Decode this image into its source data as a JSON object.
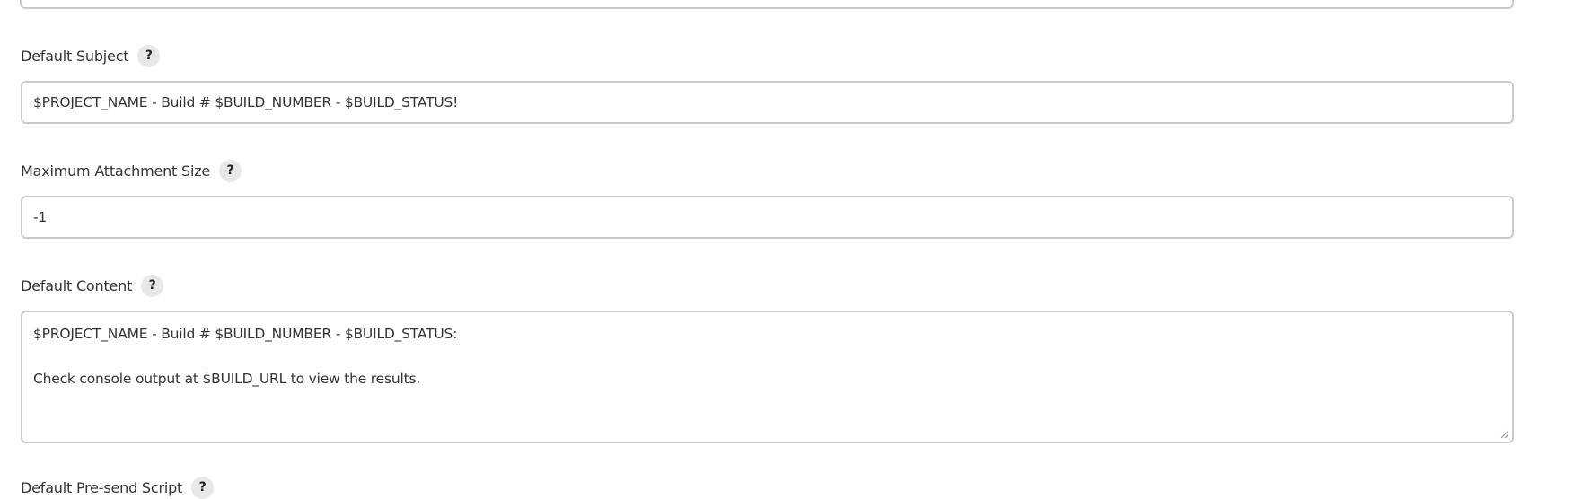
{
  "fields": {
    "default_subject": {
      "label": "Default Subject",
      "help": "?",
      "value": "$PROJECT_NAME - Build # $BUILD_NUMBER - $BUILD_STATUS!"
    },
    "max_attachment_size": {
      "label": "Maximum Attachment Size",
      "help": "?",
      "value": "-1"
    },
    "default_content": {
      "label": "Default Content",
      "help": "?",
      "lines": [
        "$PROJECT_NAME - Build # $BUILD_NUMBER - $BUILD_STATUS:",
        "",
        "Check console output at $BUILD_URL to view the results."
      ]
    },
    "default_presend_script": {
      "label": "Default Pre-send Script",
      "help": "?"
    }
  },
  "colors": {
    "border": "#c6cdd2",
    "help_bg": "#e8e8e8",
    "text": "#333333"
  }
}
